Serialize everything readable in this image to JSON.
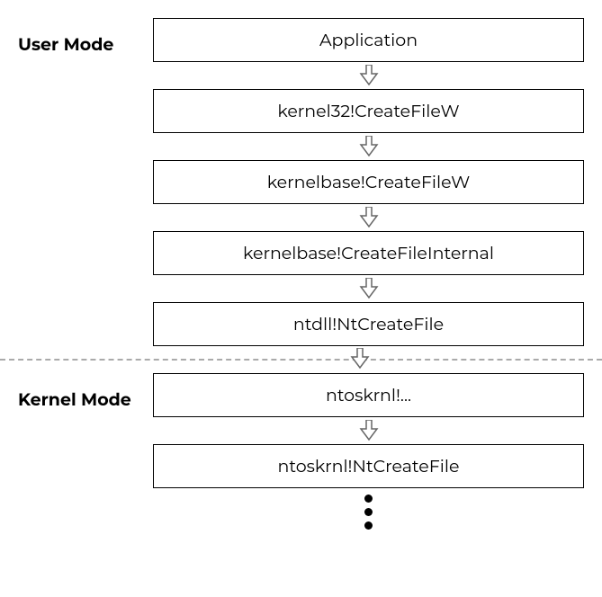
{
  "labels": {
    "user_mode": "User Mode",
    "kernel_mode": "Kernel Mode"
  },
  "user_boxes": [
    "Application",
    "kernel32!CreateFileW",
    "kernelbase!CreateFileW",
    "kernelbase!CreateFileInternal",
    "ntdll!NtCreateFile"
  ],
  "kernel_boxes": [
    "ntoskrnl!...",
    "ntoskrnl!NtCreateFile"
  ]
}
